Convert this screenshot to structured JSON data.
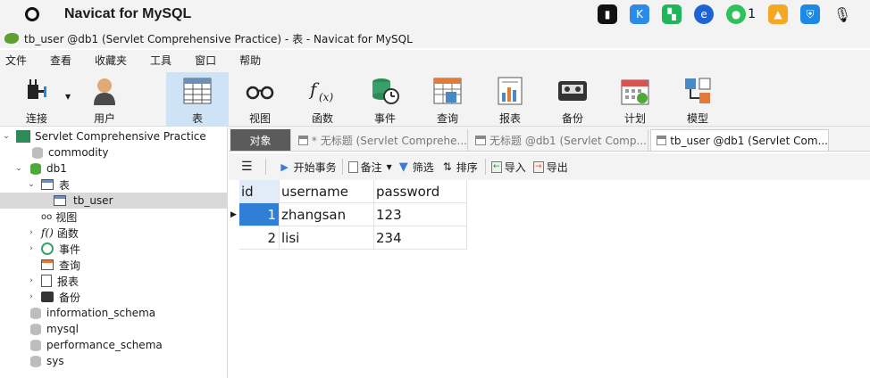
{
  "topbar": {
    "app_name": "Navicat for MySQL",
    "wechat_count": "1"
  },
  "window": {
    "title": "tb_user @db1 (Servlet Comprehensive Practice) - 表 - Navicat for MySQL"
  },
  "menu": [
    "文件",
    "查看",
    "收藏夹",
    "工具",
    "窗口",
    "帮助"
  ],
  "toolbar": [
    {
      "label": "连接",
      "icon": "plug-icon"
    },
    {
      "label": "用户",
      "icon": "user-icon"
    },
    {
      "label": "表",
      "icon": "table-icon"
    },
    {
      "label": "视图",
      "icon": "glasses-icon"
    },
    {
      "label": "函数",
      "icon": "function-icon"
    },
    {
      "label": "事件",
      "icon": "event-icon"
    },
    {
      "label": "查询",
      "icon": "query-icon"
    },
    {
      "label": "报表",
      "icon": "report-icon"
    },
    {
      "label": "备份",
      "icon": "backup-icon"
    },
    {
      "label": "计划",
      "icon": "calendar-icon"
    },
    {
      "label": "模型",
      "icon": "model-icon"
    }
  ],
  "navigator": {
    "items": [
      {
        "label": "Servlet Comprehensive Practice",
        "chev": "⌄"
      },
      {
        "label": "commodity",
        "chev": ""
      },
      {
        "label": "db1",
        "chev": "⌄"
      },
      {
        "label": "表",
        "chev": "⌄"
      },
      {
        "label": "tb_user",
        "chev": ""
      },
      {
        "label": "视图",
        "chev": ""
      },
      {
        "label": "函数",
        "chev": "›"
      },
      {
        "label": "事件",
        "chev": "›"
      },
      {
        "label": "查询",
        "chev": ""
      },
      {
        "label": "报表",
        "chev": "›"
      },
      {
        "label": "备份",
        "chev": "›"
      },
      {
        "label": "information_schema",
        "chev": ""
      },
      {
        "label": "mysql",
        "chev": ""
      },
      {
        "label": "performance_schema",
        "chev": ""
      },
      {
        "label": "sys",
        "chev": ""
      }
    ]
  },
  "tabs": {
    "objects": "对象",
    "items": [
      "* 无标题 (Servlet Comprehe...",
      "无标题 @db1 (Servlet Comp...",
      "tb_user @db1 (Servlet Com..."
    ]
  },
  "grid_toolbar": {
    "begin_transaction": "开始事务",
    "memo": "备注",
    "filter": "筛选",
    "sort": "排序",
    "import": "导入",
    "export": "导出"
  },
  "table": {
    "columns": [
      "id",
      "username",
      "password"
    ],
    "rows": [
      [
        "1",
        "zhangsan",
        "123"
      ],
      [
        "2",
        "lisi",
        "234"
      ]
    ]
  },
  "colors": {
    "accent": "#2f7fd6",
    "active_toolbar": "#cfe3f6"
  }
}
